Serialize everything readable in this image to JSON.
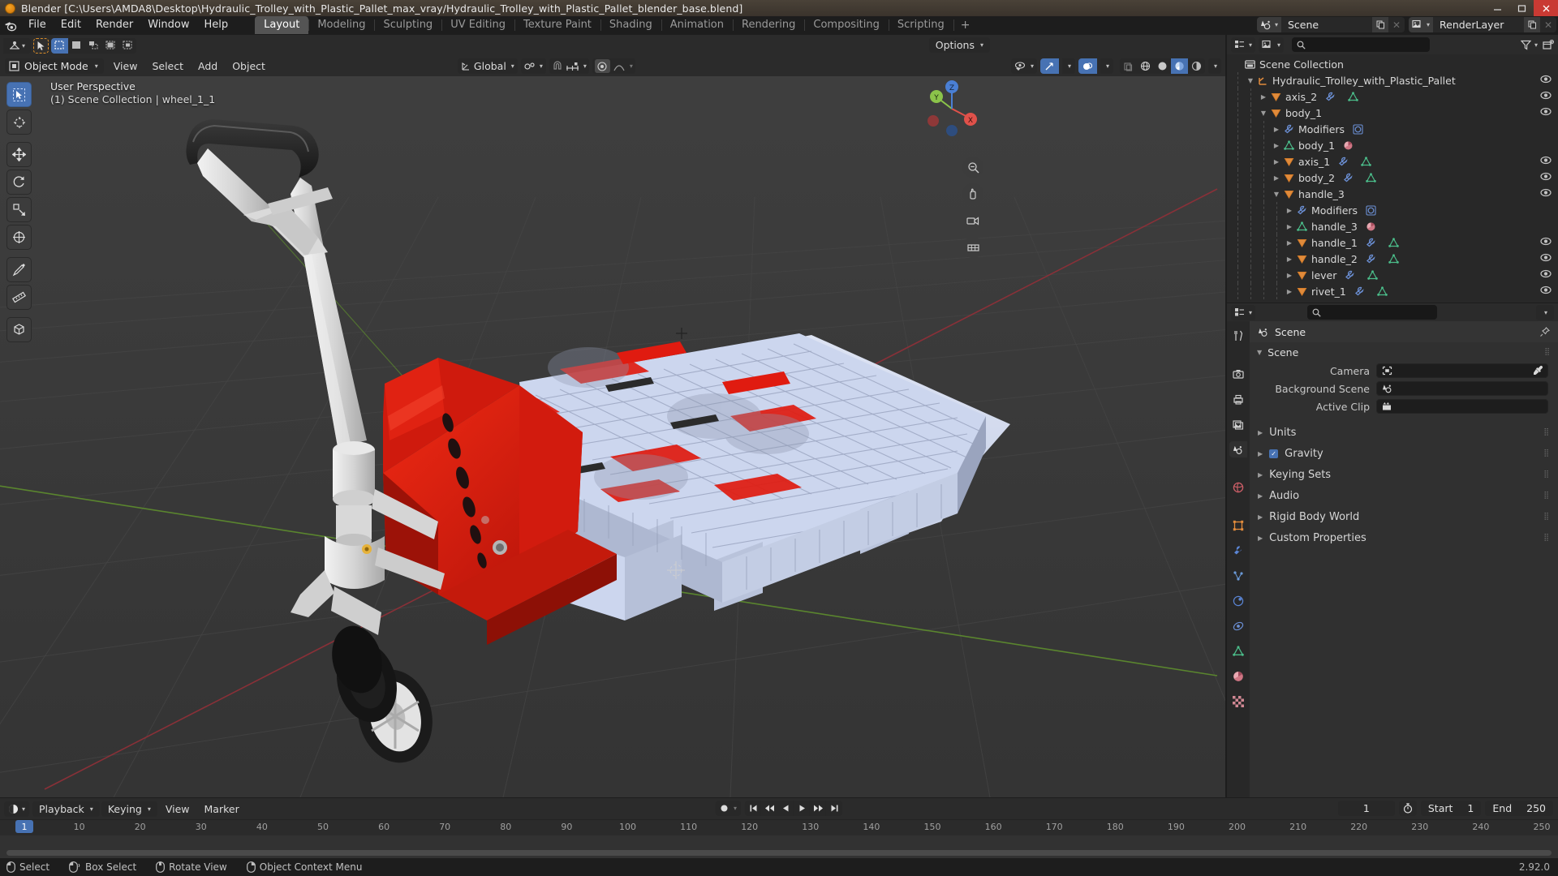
{
  "window": {
    "title": "Blender [C:\\Users\\AMDA8\\Desktop\\Hydraulic_Trolley_with_Plastic_Pallet_max_vray/Hydraulic_Trolley_with_Plastic_Pallet_blender_base.blend]",
    "minimize": "minimize-icon",
    "maximize": "maximize-icon",
    "close": "close-icon"
  },
  "topbar": {
    "logo": "blender-logo-icon",
    "menus": [
      "File",
      "Edit",
      "Render",
      "Window",
      "Help"
    ],
    "workspaces": [
      {
        "label": "Layout",
        "active": true
      },
      {
        "label": "Modeling",
        "active": false
      },
      {
        "label": "Sculpting",
        "active": false
      },
      {
        "label": "UV Editing",
        "active": false
      },
      {
        "label": "Texture Paint",
        "active": false
      },
      {
        "label": "Shading",
        "active": false
      },
      {
        "label": "Animation",
        "active": false
      },
      {
        "label": "Rendering",
        "active": false
      },
      {
        "label": "Compositing",
        "active": false
      },
      {
        "label": "Scripting",
        "active": false
      }
    ],
    "add_workspace": "+",
    "scene_name": "Scene",
    "viewlayer_name": "RenderLayer"
  },
  "viewport": {
    "tool_header": {
      "transform_orientation": "Global",
      "snap_label": "snap-magnet-icon",
      "proportional_label": "proportional-editing-icon",
      "options_label": "Options"
    },
    "mode": "Object Mode",
    "menus": [
      "View",
      "Select",
      "Add",
      "Object"
    ],
    "overlay_text_line1": "User Perspective",
    "overlay_text_line2": "(1) Scene Collection | wheel_1_1",
    "gizmo_axes": [
      {
        "label": "Z",
        "color": "#4a7fd4"
      },
      {
        "label": "Y",
        "color": "#8bc34a"
      },
      {
        "label": "X",
        "color": "#e0514a"
      }
    ],
    "tools": [
      {
        "name": "tweak-select-tool",
        "active": true
      },
      {
        "name": "cursor-tool",
        "active": false
      },
      {
        "name": "move-tool",
        "active": false
      },
      {
        "name": "rotate-tool",
        "active": false
      },
      {
        "name": "scale-tool",
        "active": false
      },
      {
        "name": "transform-tool",
        "active": false
      },
      {
        "name": "annotate-tool",
        "active": false
      },
      {
        "name": "measure-tool",
        "active": false
      },
      {
        "name": "add-cube-tool",
        "active": false
      }
    ]
  },
  "outliner": {
    "display_mode": "view-layer-icon",
    "search_placeholder": "",
    "filter_icon": "filter-icon",
    "new_collection_icon": "new-collection-icon",
    "rows": [
      {
        "label": "Scene Collection",
        "indent": 0,
        "tri": "",
        "icon": "collection-icon",
        "eye": false,
        "extra": []
      },
      {
        "label": "Hydraulic_Trolley_with_Plastic_Pallet",
        "indent": 1,
        "tri": "down",
        "icon": "empty-axes-icon",
        "eye": true,
        "extra": []
      },
      {
        "label": "axis_2",
        "indent": 2,
        "tri": "right",
        "icon": "object-mesh-icon",
        "eye": true,
        "extra": [
          "modifier-icon",
          "mesh-data-icon"
        ]
      },
      {
        "label": "body_1",
        "indent": 2,
        "tri": "down",
        "icon": "object-mesh-icon",
        "eye": true,
        "extra": []
      },
      {
        "label": "Modifiers",
        "indent": 3,
        "tri": "right",
        "icon": "modifier-icon",
        "eye": false,
        "extra": [
          "subdiv-icon"
        ]
      },
      {
        "label": "body_1",
        "indent": 3,
        "tri": "right",
        "icon": "mesh-data-icon",
        "eye": false,
        "extra": [
          "material-icon"
        ]
      },
      {
        "label": "axis_1",
        "indent": 3,
        "tri": "right",
        "icon": "object-mesh-icon",
        "eye": true,
        "extra": [
          "modifier-icon",
          "mesh-data-icon"
        ]
      },
      {
        "label": "body_2",
        "indent": 3,
        "tri": "right",
        "icon": "object-mesh-icon",
        "eye": true,
        "extra": [
          "modifier-icon",
          "mesh-data-icon"
        ]
      },
      {
        "label": "handle_3",
        "indent": 3,
        "tri": "down",
        "icon": "object-mesh-icon",
        "eye": true,
        "extra": []
      },
      {
        "label": "Modifiers",
        "indent": 4,
        "tri": "right",
        "icon": "modifier-icon",
        "eye": false,
        "extra": [
          "subdiv-icon"
        ]
      },
      {
        "label": "handle_3",
        "indent": 4,
        "tri": "right",
        "icon": "mesh-data-icon",
        "eye": false,
        "extra": [
          "material-icon"
        ]
      },
      {
        "label": "handle_1",
        "indent": 4,
        "tri": "right",
        "icon": "object-mesh-icon",
        "eye": true,
        "extra": [
          "modifier-icon",
          "mesh-data-icon"
        ]
      },
      {
        "label": "handle_2",
        "indent": 4,
        "tri": "right",
        "icon": "object-mesh-icon",
        "eye": true,
        "extra": [
          "modifier-icon",
          "mesh-data-icon"
        ]
      },
      {
        "label": "lever",
        "indent": 4,
        "tri": "right",
        "icon": "object-mesh-icon",
        "eye": true,
        "extra": [
          "modifier-icon",
          "mesh-data-icon"
        ]
      },
      {
        "label": "rivet_1",
        "indent": 4,
        "tri": "right",
        "icon": "object-mesh-icon",
        "eye": true,
        "extra": [
          "modifier-icon",
          "mesh-data-icon"
        ]
      }
    ]
  },
  "properties": {
    "editor_type_icon": "properties-editor-icon",
    "search_placeholder": "",
    "breadcrumb": "Scene",
    "pin_icon": "pin-icon",
    "panel_title": "Scene",
    "fields": [
      {
        "label": "Camera",
        "value": "",
        "icon": "camera-icon",
        "eyedropper": true
      },
      {
        "label": "Background Scene",
        "value": "",
        "icon": "scene-icon",
        "eyedropper": false
      },
      {
        "label": "Active Clip",
        "value": "",
        "icon": "clip-icon",
        "eyedropper": false
      }
    ],
    "sections": [
      {
        "label": "Units",
        "checkbox": false,
        "checked": false
      },
      {
        "label": "Gravity",
        "checkbox": true,
        "checked": true
      },
      {
        "label": "Keying Sets",
        "checkbox": false,
        "checked": false
      },
      {
        "label": "Audio",
        "checkbox": false,
        "checked": false
      },
      {
        "label": "Rigid Body World",
        "checkbox": false,
        "checked": false
      },
      {
        "label": "Custom Properties",
        "checkbox": false,
        "checked": false
      }
    ],
    "tabs": [
      {
        "name": "tool-tab",
        "active": false
      },
      {
        "name": "render-tab",
        "active": false
      },
      {
        "name": "output-tab",
        "active": false
      },
      {
        "name": "view-layer-tab",
        "active": false
      },
      {
        "name": "scene-tab",
        "active": true
      },
      {
        "name": "world-tab",
        "active": false
      },
      {
        "name": "object-tab",
        "active": false
      },
      {
        "name": "modifier-tab",
        "active": false
      },
      {
        "name": "particles-tab",
        "active": false
      },
      {
        "name": "physics-tab",
        "active": false
      },
      {
        "name": "constraints-tab",
        "active": false
      },
      {
        "name": "object-data-tab",
        "active": false
      },
      {
        "name": "material-tab",
        "active": false
      },
      {
        "name": "texture-tab",
        "active": false
      }
    ]
  },
  "timeline": {
    "editor_icon": "timeline-editor-icon",
    "menus": [
      "Playback",
      "Keying",
      "View",
      "Marker"
    ],
    "record_icon": "auto-keying-icon",
    "transport": [
      "jump-start-icon",
      "prev-keyframe-icon",
      "play-reverse-icon",
      "play-icon",
      "next-keyframe-icon",
      "jump-end-icon"
    ],
    "current_frame": "1",
    "use_preview_range_icon": "stopwatch-icon",
    "start_label": "Start",
    "start_value": "1",
    "end_label": "End",
    "end_value": "250",
    "ticks": [
      1,
      10,
      20,
      30,
      40,
      50,
      60,
      70,
      80,
      90,
      100,
      110,
      120,
      130,
      140,
      150,
      160,
      170,
      180,
      190,
      200,
      210,
      220,
      230,
      240,
      250
    ],
    "playhead_frame": 1
  },
  "statusbar": {
    "items": [
      {
        "mouse": "left",
        "label": "Select"
      },
      {
        "mouse": "left-drag",
        "label": "Box Select"
      },
      {
        "mouse": "middle",
        "label": "Rotate View"
      },
      {
        "mouse": "right",
        "label": "Object Context Menu"
      }
    ],
    "version": "2.92.0"
  },
  "colors": {
    "accent": "#4772b3",
    "orange": "#d98c28",
    "panel_bg": "#303030",
    "outliner_bg": "#282828",
    "viewport_bg": "#393939",
    "trolley_red": "#e01b10",
    "pallet_blue": "#ccd6ee",
    "axis_x": "#e0514a",
    "axis_y": "#8bc34a",
    "axis_z": "#4a7fd4"
  }
}
